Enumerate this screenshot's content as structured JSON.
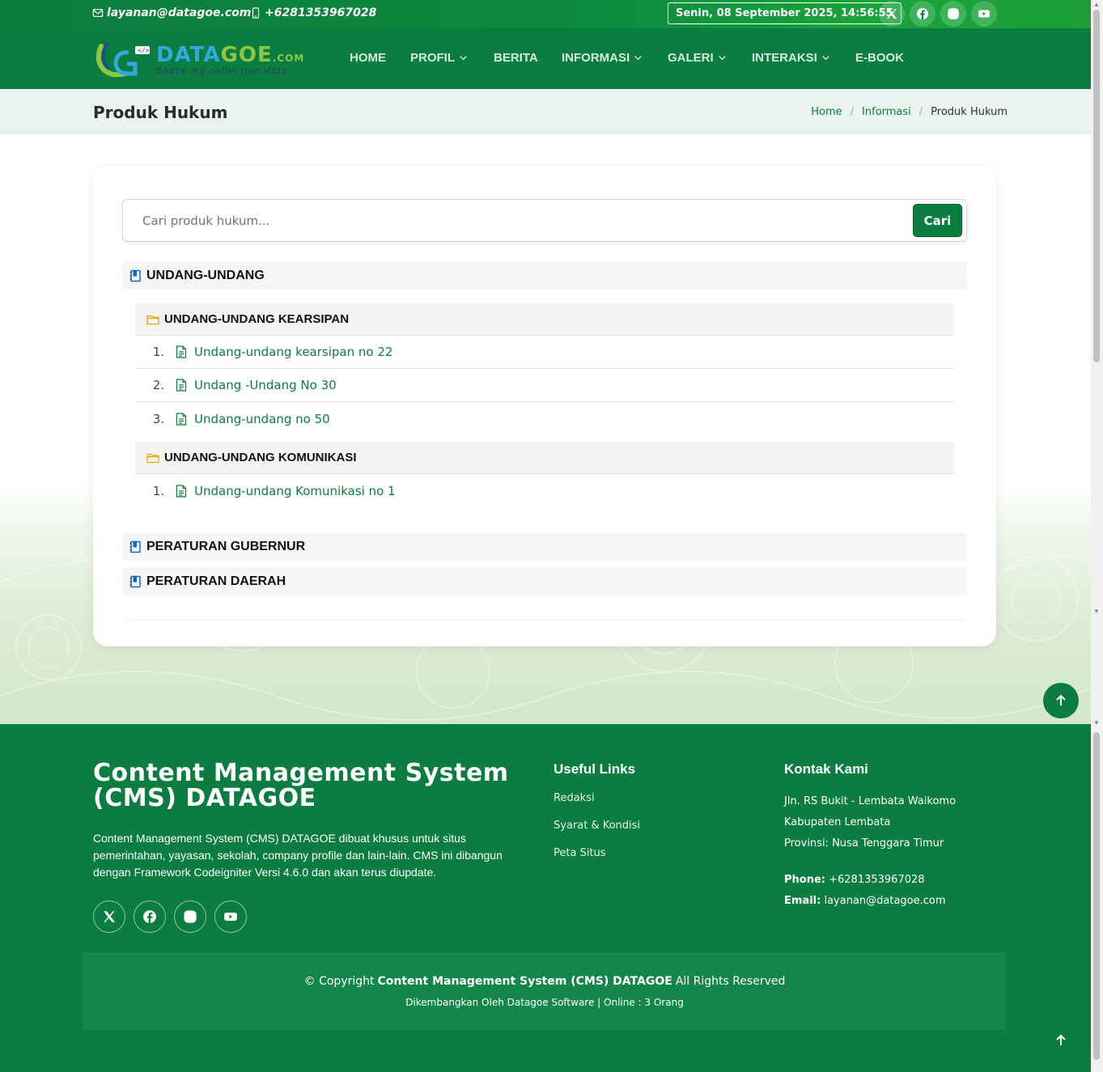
{
  "topbar": {
    "email": "layanan@datagoe.com",
    "phone": "+6281353967028",
    "datetime": "Senin, 08 September 2025, 14:56:55",
    "socials": [
      "x-icon",
      "facebook-icon",
      "instagram-icon",
      "youtube-icon"
    ]
  },
  "logo": {
    "brand_main": "DATA",
    "brand_accent": "GOE",
    "brand_tld": ".COM",
    "tagline": "Share my collection data"
  },
  "nav": {
    "items": [
      {
        "label": "HOME",
        "dropdown": false
      },
      {
        "label": "PROFIL",
        "dropdown": true
      },
      {
        "label": "BERITA",
        "dropdown": false
      },
      {
        "label": "INFORMASI",
        "dropdown": true
      },
      {
        "label": "GALERI",
        "dropdown": true
      },
      {
        "label": "INTERAKSI",
        "dropdown": true
      },
      {
        "label": "E-BOOK",
        "dropdown": false
      }
    ]
  },
  "page_header": {
    "title": "Produk Hukum",
    "breadcrumb": [
      "Home",
      "Informasi",
      "Produk Hukum"
    ]
  },
  "search": {
    "placeholder": "Cari produk hukum...",
    "button": "Cari"
  },
  "categories": [
    {
      "title": "UNDANG-UNDANG",
      "subcategories": [
        {
          "title": "UNDANG-UNDANG KEARSIPAN",
          "documents": [
            {
              "num": "1.",
              "title": "Undang-undang kearsipan no 22"
            },
            {
              "num": "2.",
              "title": "Undang -Undang No 30"
            },
            {
              "num": "3.",
              "title": "Undang-undang no 50"
            }
          ]
        },
        {
          "title": "UNDANG-UNDANG KOMUNIKASI",
          "documents": [
            {
              "num": "1.",
              "title": "Undang-undang Komunikasi no 1"
            }
          ]
        }
      ]
    },
    {
      "title": "PERATURAN GUBERNUR",
      "subcategories": []
    },
    {
      "title": "PERATURAN DAERAH",
      "subcategories": []
    }
  ],
  "footer": {
    "title": "Content Management System (CMS) DATAGOE",
    "description": "Content Management System (CMS) DATAGOE dibuat khusus untuk situs pemerintahan, yayasan, sekolah, company profile dan lain-lain. CMS ini dibangun dengan Framework Codeigniter Versi 4.6.0 dan akan terus diupdate.",
    "useful_links_heading": "Useful Links",
    "useful_links": [
      "Redaksi",
      "Syarat & Kondisi",
      "Peta Situs"
    ],
    "contact_heading": "Kontak Kami",
    "address_lines": [
      "Jln. RS Bukit - Lembata Waikomo",
      "Kabupaten Lembata",
      "Provinsi: Nusa Tenggara Timur"
    ],
    "phone_label": "Phone:",
    "phone": "+6281353967028",
    "email_label": "Email:",
    "email": "layanan@datagoe.com",
    "copyright_prefix": "© Copyright",
    "copyright_name": "Content Management System (CMS) DATAGOE",
    "copyright_suffix": "All Rights Reserved",
    "developer_line": "Dikembangkan Oleh Datagoe Software | Online : 3 Orang"
  },
  "colors": {
    "primary": "#0b7d40",
    "accent_blue": "#1565c0",
    "folder": "#f0a500"
  }
}
